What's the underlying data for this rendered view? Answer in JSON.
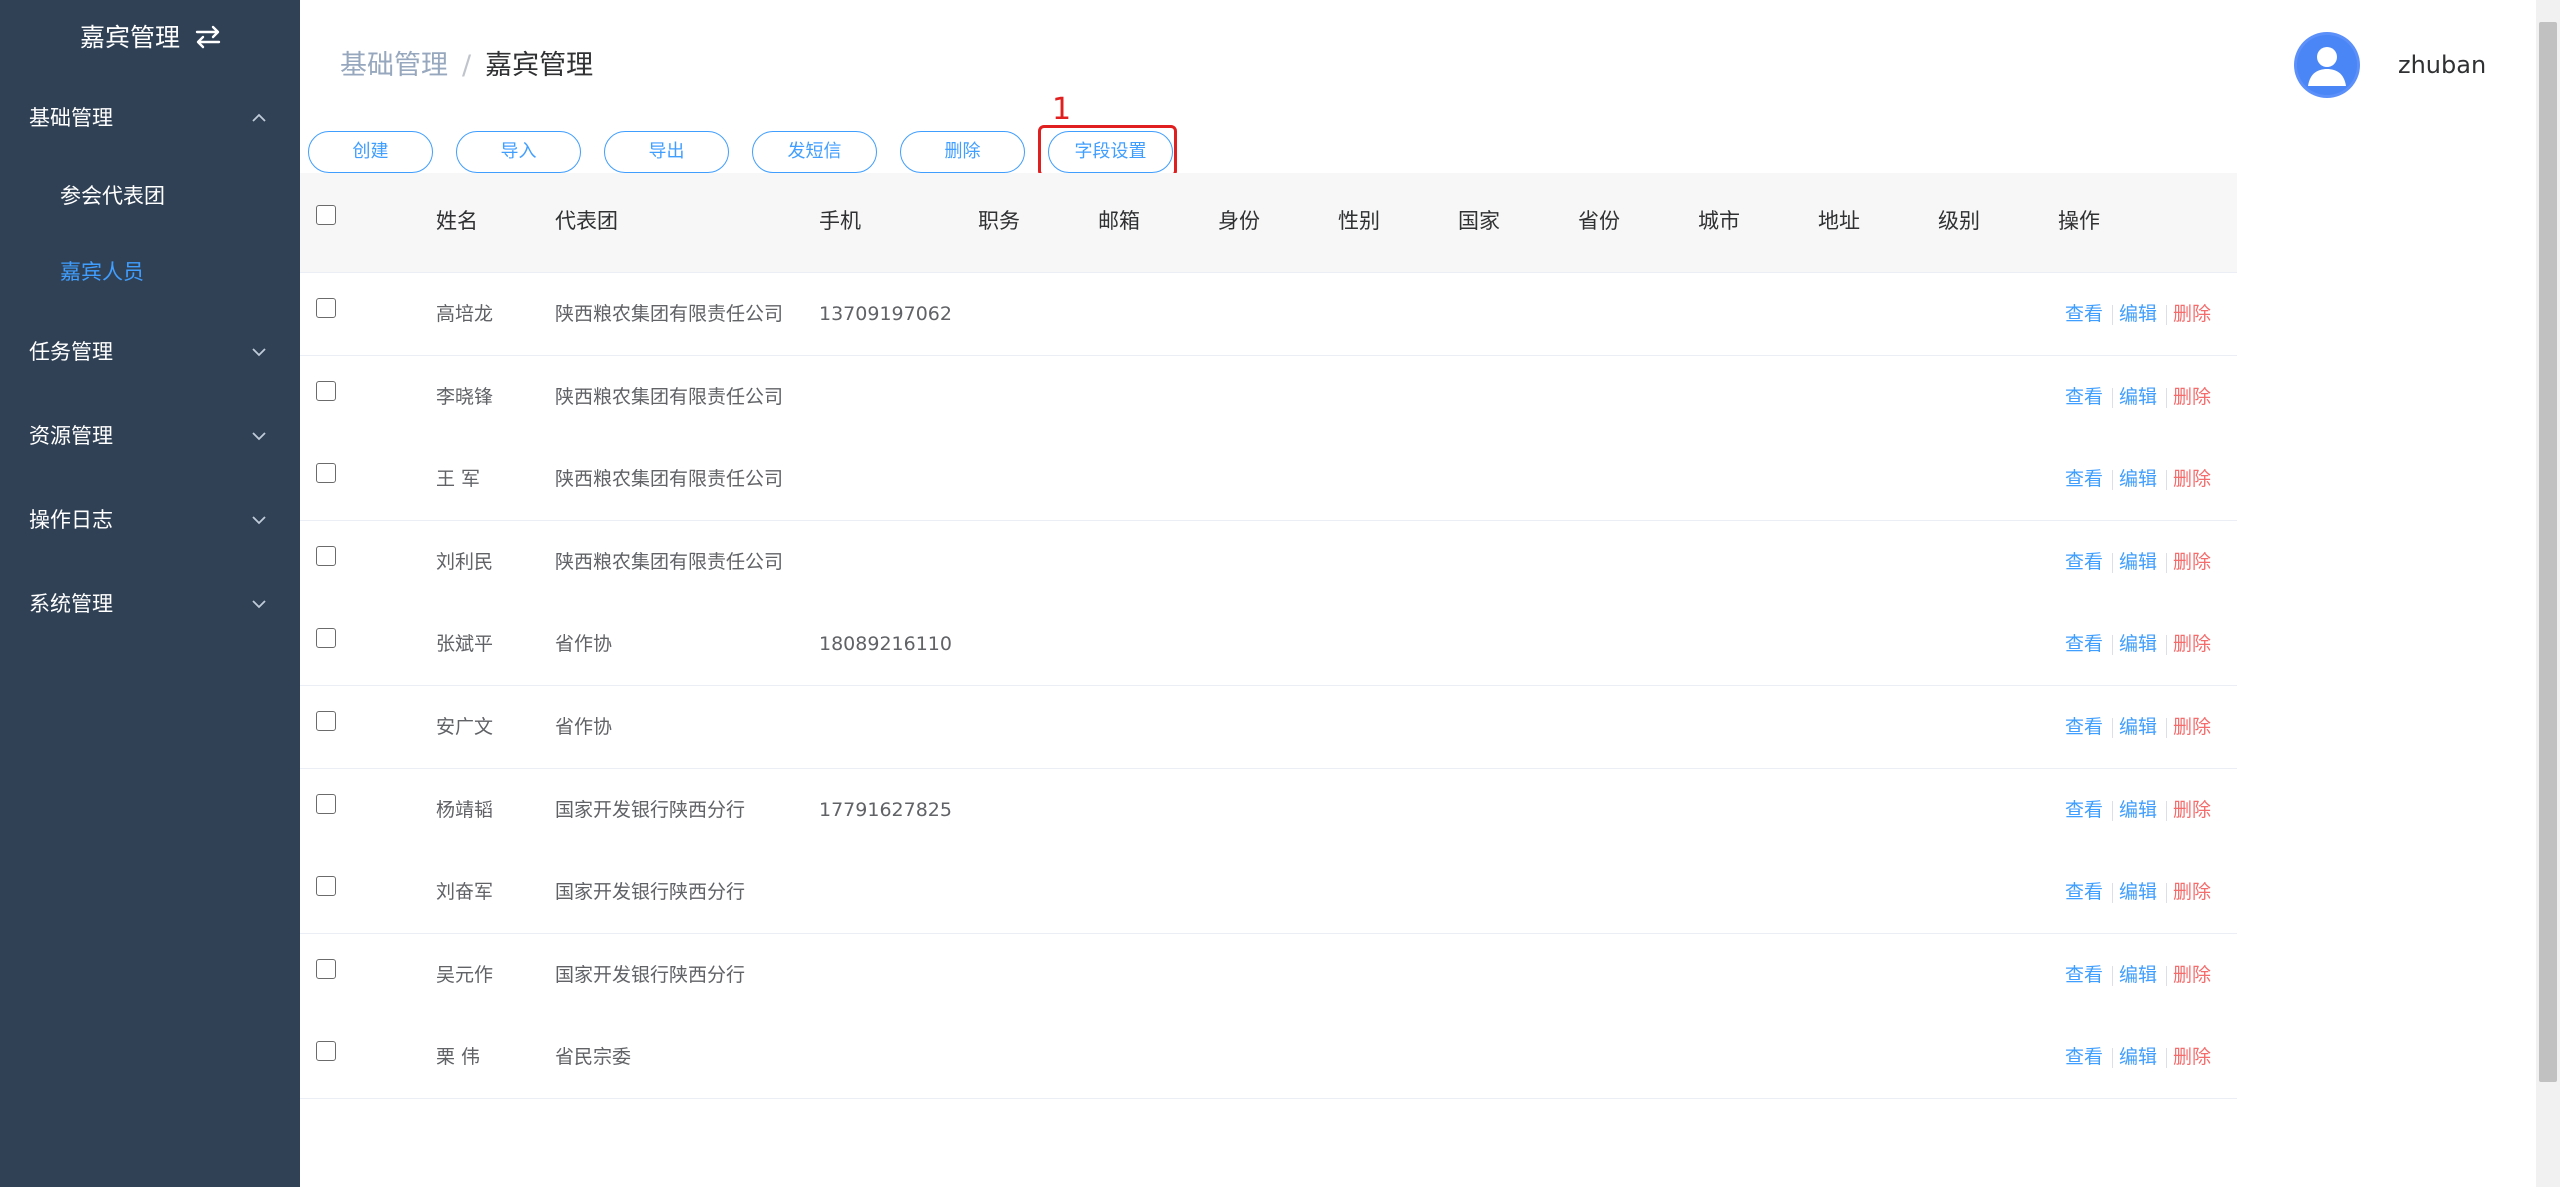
{
  "sidebar": {
    "title": "嘉宾管理",
    "menus": [
      {
        "label": "基础管理",
        "expanded": true
      },
      {
        "label": "任务管理",
        "expanded": false
      },
      {
        "label": "资源管理",
        "expanded": false
      },
      {
        "label": "操作日志",
        "expanded": false
      },
      {
        "label": "系统管理",
        "expanded": false
      }
    ],
    "submenus": [
      {
        "label": "参会代表团",
        "active": false
      },
      {
        "label": "嘉宾人员",
        "active": true
      }
    ]
  },
  "header": {
    "breadcrumb_parent": "基础管理",
    "breadcrumb_sep": "/",
    "breadcrumb_current": "嘉宾管理",
    "username": "zhuban"
  },
  "toolbar": {
    "buttons": [
      "创建",
      "导入",
      "导出",
      "发短信",
      "删除",
      "字段设置"
    ],
    "highlight_label": "1"
  },
  "table": {
    "columns": [
      "姓名",
      "代表团",
      "手机",
      "职务",
      "邮箱",
      "身份",
      "性别",
      "国家",
      "省份",
      "城市",
      "地址",
      "级别",
      "操作"
    ],
    "actions": {
      "view": "查看",
      "edit": "编辑",
      "delete": "删除"
    },
    "rows": [
      {
        "name": "高培龙",
        "delegation": "陕西粮农集团有限责任公司",
        "phone": "13709197062"
      },
      {
        "name": "李晓锋",
        "delegation": "陕西粮农集团有限责任公司",
        "phone": ""
      },
      {
        "name": "王 军",
        "delegation": "陕西粮农集团有限责任公司",
        "phone": ""
      },
      {
        "name": "刘利民",
        "delegation": "陕西粮农集团有限责任公司",
        "phone": ""
      },
      {
        "name": "张斌平",
        "delegation": "省作协",
        "phone": "18089216110"
      },
      {
        "name": "安广文",
        "delegation": "省作协",
        "phone": ""
      },
      {
        "name": "杨靖韬",
        "delegation": "国家开发银行陕西分行",
        "phone": "17791627825"
      },
      {
        "name": "刘奋军",
        "delegation": "国家开发银行陕西分行",
        "phone": ""
      },
      {
        "name": "吴元作",
        "delegation": "国家开发银行陕西分行",
        "phone": ""
      },
      {
        "name": "栗 伟",
        "delegation": "省民宗委",
        "phone": ""
      }
    ]
  },
  "colors": {
    "sidebar_bg": "#304156",
    "accent": "#409eff",
    "danger": "#f56c6c",
    "highlight": "#e02020"
  }
}
